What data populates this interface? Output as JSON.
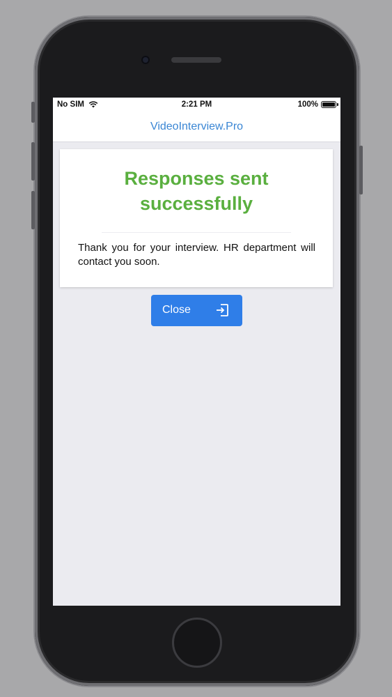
{
  "status_bar": {
    "carrier": "No SIM",
    "time": "2:21 PM",
    "battery": "100%",
    "battery_level": 1.0
  },
  "header": {
    "title": "VideoInterview.Pro"
  },
  "card": {
    "title": "Responses sent successfully",
    "message": "Thank you for your interview. HR department will contact you soon."
  },
  "close_button": {
    "label": "Close",
    "icon": "exit-icon"
  },
  "colors": {
    "accent_blue": "#2f7ee8",
    "link_blue": "#3a86d4",
    "success_green": "#5aaf3f",
    "screen_background": "#ebebf0"
  }
}
